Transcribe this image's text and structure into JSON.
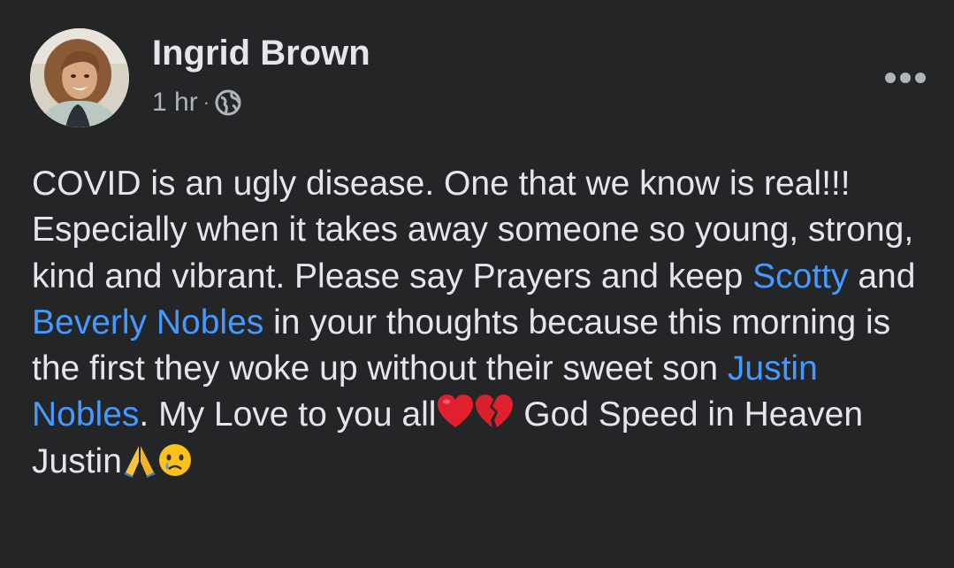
{
  "post": {
    "author": "Ingrid Brown",
    "timestamp": "1 hr",
    "separator": "·",
    "privacy_icon": "globe-icon",
    "more_icon": "more-options-icon",
    "body": {
      "line1_part1": "COVID is an ugly disease. One that we know is real!!! Especially when it takes away someone so young, strong, kind and vibrant. Please say Prayers and keep ",
      "mention1": "Scotty",
      "and_text": " and ",
      "mention2": "Beverly Nobles",
      "part2": " in your thoughts because this morning is the first they woke up without their sweet son ",
      "mention3": "Justin Nobles",
      "part3": ". My Love to you all",
      "emoji1": "red-heart-emoji",
      "emoji2": "broken-heart-emoji",
      "part4": " God Speed in Heaven Justin",
      "emoji3": "folded-hands-emoji",
      "emoji4": "crying-face-emoji"
    }
  },
  "colors": {
    "background": "#242526",
    "text": "#e4e6eb",
    "secondary_text": "#b0b3b8",
    "mention": "#4599ff"
  }
}
